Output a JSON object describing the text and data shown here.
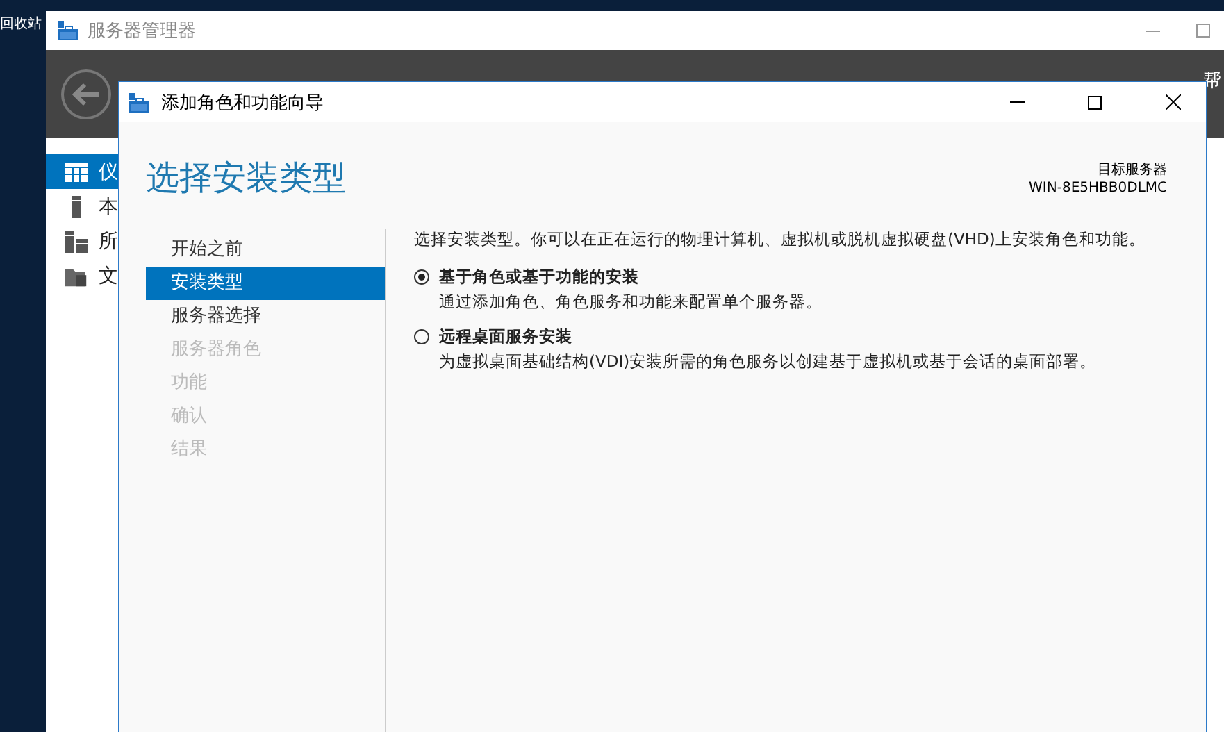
{
  "desktop": {
    "icon_label": "回收站"
  },
  "server_manager": {
    "title": "服务器管理器",
    "toolbar_partial_text": "帮",
    "sidebar": [
      {
        "label": "仪",
        "selected": true
      },
      {
        "label": "本",
        "selected": false
      },
      {
        "label": "所",
        "selected": false
      },
      {
        "label": "文",
        "selected": false
      }
    ]
  },
  "wizard": {
    "title": "添加角色和功能向导",
    "heading": "选择安装类型",
    "target_label": "目标服务器",
    "target_server": "WIN-8E5HBB0DLMC",
    "steps": [
      {
        "label": "开始之前",
        "selected": false,
        "disabled": false
      },
      {
        "label": "安装类型",
        "selected": true,
        "disabled": false
      },
      {
        "label": "服务器选择",
        "selected": false,
        "disabled": false
      },
      {
        "label": "服务器角色",
        "selected": false,
        "disabled": true
      },
      {
        "label": "功能",
        "selected": false,
        "disabled": true
      },
      {
        "label": "确认",
        "selected": false,
        "disabled": true
      },
      {
        "label": "结果",
        "selected": false,
        "disabled": true
      }
    ],
    "intro": "选择安装类型。你可以在正在运行的物理计算机、虚拟机或脱机虚拟硬盘(VHD)上安装角色和功能。",
    "options": [
      {
        "label": "基于角色或基于功能的安装",
        "description": "通过添加角色、角色服务和功能来配置单个服务器。",
        "selected": true
      },
      {
        "label": "远程桌面服务安装",
        "description": "为虚拟桌面基础结构(VDI)安装所需的角色服务以创建基于虚拟机或基于会话的桌面部署。",
        "selected": false
      }
    ]
  }
}
